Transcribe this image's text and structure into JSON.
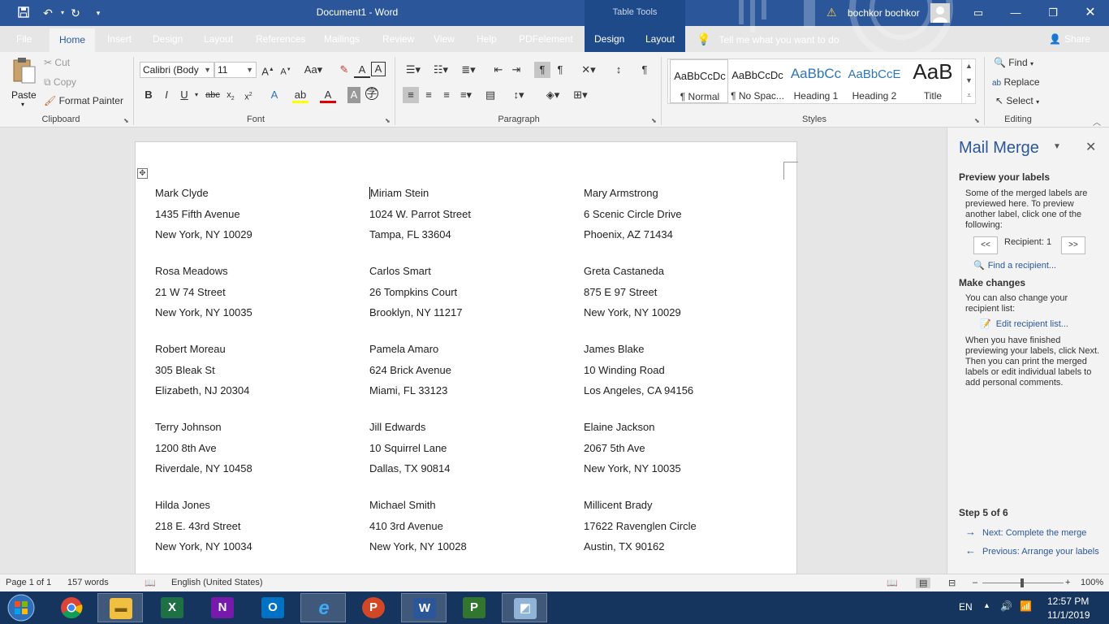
{
  "titlebar": {
    "document_title": "Document1  -  Word",
    "table_tools": "Table Tools",
    "user": "bochkor bochkor"
  },
  "tabs": [
    {
      "label": "File"
    },
    {
      "label": "Home"
    },
    {
      "label": "Insert"
    },
    {
      "label": "Design"
    },
    {
      "label": "Layout"
    },
    {
      "label": "References"
    },
    {
      "label": "Mailings"
    },
    {
      "label": "Review"
    },
    {
      "label": "View"
    },
    {
      "label": "Help"
    },
    {
      "label": "PDFelement"
    },
    {
      "label": "Design"
    },
    {
      "label": "Layout"
    }
  ],
  "tell_me": "Tell me what you want to do",
  "share": "Share",
  "clipboard": {
    "paste": "Paste",
    "cut": "Cut",
    "copy": "Copy",
    "format_painter": "Format Painter",
    "label": "Clipboard"
  },
  "font": {
    "name": "Calibri (Body",
    "size": "11",
    "label": "Font"
  },
  "paragraph": {
    "label": "Paragraph"
  },
  "styles": {
    "label": "Styles",
    "items": [
      {
        "sample": "AaBbCcDc",
        "name": "¶ Normal"
      },
      {
        "sample": "AaBbCcDc",
        "name": "¶ No Spac..."
      },
      {
        "sample": "AaBbCc",
        "name": "Heading 1"
      },
      {
        "sample": "AaBbCcE",
        "name": "Heading 2"
      },
      {
        "sample": "AaB",
        "name": "Title"
      }
    ]
  },
  "editing": {
    "find": "Find",
    "replace": "Replace",
    "select": "Select",
    "label": "Editing"
  },
  "labels": [
    {
      "name": "Mark Clyde",
      "street": "1435 Fifth Avenue",
      "city": "New York, NY 10029"
    },
    {
      "name": "Miriam Stein",
      "street": "1024 W. Parrot Street",
      "city": "Tampa, FL 33604"
    },
    {
      "name": "Mary Armstrong",
      "street": "6 Scenic Circle Drive",
      "city": "Phoenix, AZ 71434"
    },
    {
      "name": "Rosa Meadows",
      "street": "21 W 74 Street",
      "city": "New York, NY 10035"
    },
    {
      "name": "Carlos Smart",
      "street": "26 Tompkins Court",
      "city": "Brooklyn, NY 11217"
    },
    {
      "name": "Greta Castaneda",
      "street": "875 E 97 Street",
      "city": "New York, NY 10029"
    },
    {
      "name": "Robert Moreau",
      "street": "305 Bleak St",
      "city": "Elizabeth, NJ 20304"
    },
    {
      "name": "Pamela Amaro",
      "street": "624 Brick Avenue",
      "city": "Miami, FL 33123"
    },
    {
      "name": "James Blake",
      "street": "10 Winding Road",
      "city": "Los Angeles, CA 94156"
    },
    {
      "name": "Terry Johnson",
      "street": "1200 8th Ave",
      "city": "Riverdale, NY 10458"
    },
    {
      "name": "Jill Edwards",
      "street": "10 Squirrel Lane",
      "city": "Dallas, TX 90814"
    },
    {
      "name": "Elaine Jackson",
      "street": "2067 5th Ave",
      "city": "New York, NY 10035"
    },
    {
      "name": "Hilda Jones",
      "street": "218 E. 43rd Street",
      "city": "New York, NY 10034"
    },
    {
      "name": "Michael Smith",
      "street": "410 3rd Avenue",
      "city": "New York, NY 10028"
    },
    {
      "name": "Millicent Brady",
      "street": "17622 Ravenglen Circle",
      "city": "Austin, TX 90162"
    }
  ],
  "mail_merge": {
    "title": "Mail Merge",
    "preview_heading": "Preview your labels",
    "preview_text": "Some of the merged labels are previewed here. To preview another label, click one of the following:",
    "prev_btn": "<<",
    "recipient": "Recipient: 1",
    "next_btn": ">>",
    "find_recipient": "Find a recipient...",
    "changes_heading": "Make changes",
    "changes_text": "You can also change your recipient list:",
    "edit_list": "Edit recipient list...",
    "finish_text": "When you have finished previewing your labels, click Next. Then you can print the merged labels or edit individual labels to add personal comments.",
    "step": "Step 5 of 6",
    "next_link": "Next: Complete the merge",
    "prev_link": "Previous: Arrange your labels"
  },
  "status": {
    "page": "Page 1 of 1",
    "words": "157 words",
    "language": "English (United States)",
    "zoom": "100%"
  },
  "tray": {
    "lang": "EN",
    "time": "12:57 PM",
    "date": "11/1/2019"
  }
}
